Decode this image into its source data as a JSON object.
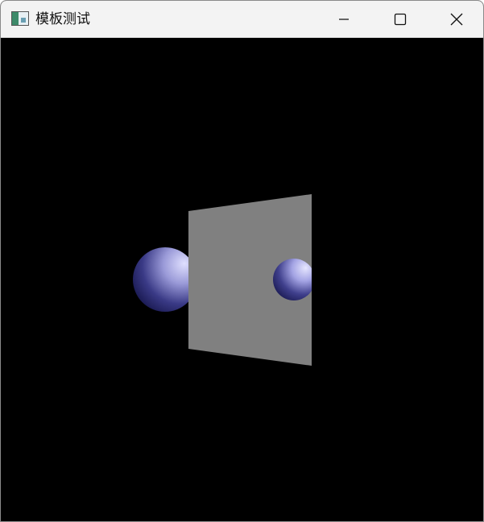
{
  "window": {
    "title": "模板测试",
    "icon": "app-window-icon",
    "controls": {
      "minimize_icon": "minimize-icon",
      "maximize_icon": "maximize-icon",
      "close_icon": "close-icon"
    }
  },
  "scene": {
    "background_color": "#000000",
    "plane_color": "#808080",
    "sphere_color": "#b8b8ff",
    "objects": [
      "sphere-left",
      "translucent-plane",
      "sphere-right"
    ]
  }
}
